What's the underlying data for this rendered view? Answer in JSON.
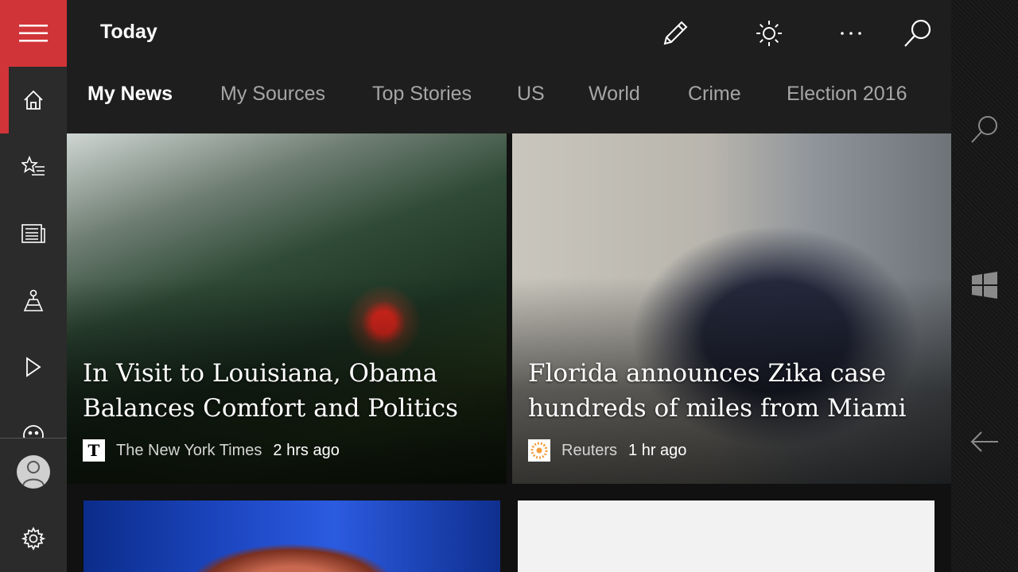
{
  "header": {
    "title": "Today"
  },
  "tabs": [
    {
      "label": "My News",
      "selected": true
    },
    {
      "label": "My Sources"
    },
    {
      "label": "Top Stories"
    },
    {
      "label": "US"
    },
    {
      "label": "World"
    },
    {
      "label": "Crime"
    },
    {
      "label": "Election 2016"
    }
  ],
  "rail": {
    "items": [
      "home-icon",
      "favorites-icon",
      "news-icon",
      "local-icon",
      "video-icon",
      "emoji-icon"
    ],
    "accent": "#d13438"
  },
  "toolbar": {
    "icons": [
      "edit-icon",
      "brightness-icon",
      "more-icon",
      "search-icon"
    ]
  },
  "cards": [
    {
      "title": "In Visit to Louisiana, Obama Balances Comfort and Politics",
      "source": "The New York Times",
      "time": "2 hrs ago",
      "logo": "nyt-logo-icon"
    },
    {
      "title": "Florida announces Zika case hundreds of miles from Miami",
      "source": "Reuters",
      "time": "1 hr ago",
      "logo": "reuters-logo-icon"
    }
  ],
  "system": {
    "icons": [
      "search-icon",
      "windows-icon",
      "back-icon"
    ]
  }
}
